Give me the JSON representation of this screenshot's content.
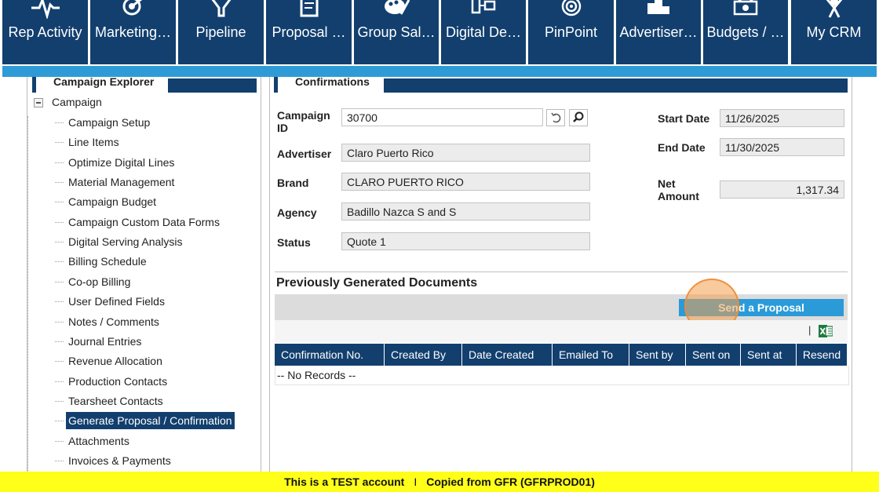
{
  "nav": {
    "tabs": [
      {
        "label": "Rep Activity",
        "icon": "activity-icon"
      },
      {
        "label": "Marketing…",
        "icon": "target-arrow-icon"
      },
      {
        "label": "Pipeline",
        "icon": "funnel-icon"
      },
      {
        "label": "Proposal …",
        "icon": "document-edit-icon"
      },
      {
        "label": "Group Sal…",
        "icon": "palette-icon"
      },
      {
        "label": "Digital De…",
        "icon": "devices-icon"
      },
      {
        "label": "PinPoint",
        "icon": "bullseye-icon"
      },
      {
        "label": "Advertiser…",
        "icon": "podium-icon"
      },
      {
        "label": "Budgets / …",
        "icon": "money-icon"
      },
      {
        "label": "My CRM",
        "icon": "person-icon"
      }
    ]
  },
  "left_panel": {
    "title": "Campaign Explorer",
    "root_label": "Campaign",
    "items": [
      "Campaign Setup",
      "Line Items",
      "Optimize Digital Lines",
      "Material Management",
      "Campaign Budget",
      "Campaign Custom Data Forms",
      "Digital Serving Analysis",
      "Billing Schedule",
      "Co-op Billing",
      "User Defined Fields",
      "Notes / Comments",
      "Journal Entries",
      "Revenue Allocation",
      "Production Contacts",
      "Tearsheet Contacts",
      "Generate Proposal / Confirmation",
      "Attachments",
      "Invoices & Payments"
    ],
    "selected_item": "Generate Proposal / Confirmation"
  },
  "main": {
    "title": "Confirmations",
    "fields": {
      "campaign_id_label": "Campaign ID",
      "campaign_id": "30700",
      "advertiser_label": "Advertiser",
      "advertiser": "Claro Puerto Rico",
      "brand_label": "Brand",
      "brand": "CLARO PUERTO RICO",
      "agency_label": "Agency",
      "agency": "Badillo Nazca S and S",
      "status_label": "Status",
      "status": "Quote 1",
      "start_date_label": "Start Date",
      "start_date": "11/26/2025",
      "end_date_label": "End Date",
      "end_date": "11/30/2025",
      "net_amount_label": "Net Amount",
      "net_amount": "1,317.34"
    },
    "documents": {
      "section_title": "Previously Generated Documents",
      "send_button": "Send a Proposal",
      "separator": "|",
      "columns": [
        "Confirmation No.",
        "Created By",
        "Date Created",
        "Emailed To",
        "Sent by",
        "Sent on",
        "Sent at",
        "Resend"
      ],
      "empty_text": "-- No Records --"
    }
  },
  "footer": {
    "left": "This is a TEST account",
    "separator": "I",
    "right": "Copied from GFR (GFRPROD01)"
  },
  "colors": {
    "nav_bg": "#123f6e",
    "accent_bar": "#2e9bd6",
    "button_blue": "#2a9bd8",
    "footer_bg": "#ffff1a",
    "highlight_orange": "#f49e4e"
  }
}
